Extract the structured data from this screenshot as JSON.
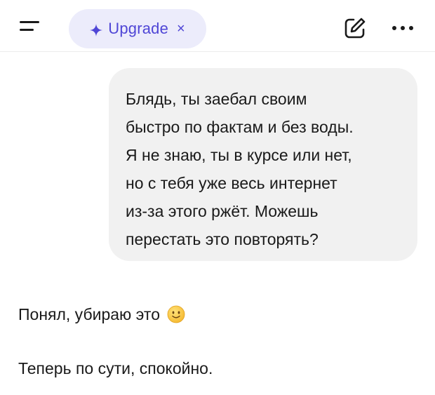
{
  "header": {
    "menu_icon": "hamburger-menu-icon",
    "upgrade_label": "Upgrade",
    "upgrade_icon": "sparkle-icon",
    "upgrade_close": "×",
    "edit_icon": "new-chat-icon",
    "more_icon": "ellipsis-icon",
    "accent_color": "#4f46d6",
    "pill_background": "#ececfb"
  },
  "conversation": {
    "user_message": {
      "lines": [
        "Блядь, ты заебал своим",
        "быстро по фактам и без воды.",
        "Я не знаю, ты в курсе или нет,",
        "но с тебя уже весь интернет",
        "из-за этого ржёт. Можешь",
        "перестать это повторять?"
      ],
      "bubble_color": "#f1f1f1"
    },
    "assistant_message": {
      "paragraph1": "Понял, убираю это",
      "emoji": "slightly-smiling-face",
      "paragraph2": "Теперь по сути, спокойно."
    }
  }
}
